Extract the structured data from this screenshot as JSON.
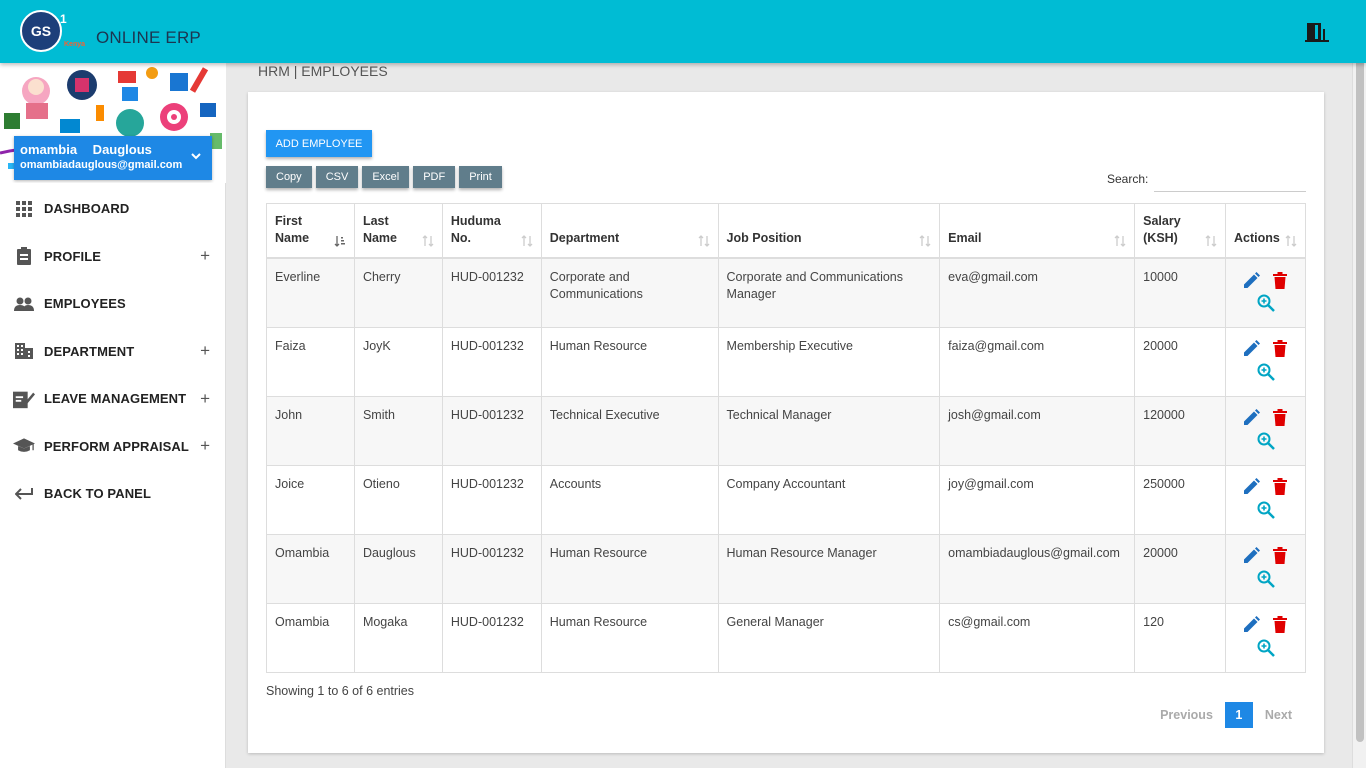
{
  "header": {
    "logo_text": "GS",
    "logo_number": "1",
    "logo_sub": "Kenya",
    "app_title": "ONLINE ERP",
    "exit_icon": "exit-door-icon"
  },
  "user": {
    "name": "omambia Dauglous",
    "email": "omambiadauglous@gmail.com"
  },
  "sidebar": {
    "items": [
      {
        "label": "DASHBOARD",
        "icon": "grid-icon",
        "expandable": false
      },
      {
        "label": "PROFILE",
        "icon": "clipboard-icon",
        "expandable": true
      },
      {
        "label": "EMPLOYEES",
        "icon": "people-icon",
        "expandable": false
      },
      {
        "label": "DEPARTMENT",
        "icon": "building-icon",
        "expandable": true
      },
      {
        "label": "LEAVE MANAGEMENT",
        "icon": "edit-doc-icon",
        "expandable": true
      },
      {
        "label": "PERFORM APPRAISAL",
        "icon": "graduation-cap-icon",
        "expandable": true
      },
      {
        "label": "BACK TO PANEL",
        "icon": "arrow-back-icon",
        "expandable": false
      }
    ],
    "plus": "+"
  },
  "breadcrumb": "HRM | EMPLOYEES",
  "toolbar": {
    "add_label": "ADD EMPLOYEE",
    "export_buttons": [
      "Copy",
      "CSV",
      "Excel",
      "PDF",
      "Print"
    ],
    "search_label": "Search:",
    "search_value": ""
  },
  "table": {
    "headers": [
      [
        "First",
        "Name"
      ],
      [
        "Last",
        "Name"
      ],
      [
        "Huduma",
        "No."
      ],
      [
        "Department"
      ],
      [
        "Job Position"
      ],
      [
        "Email"
      ],
      [
        "Salary",
        "(KSH)"
      ],
      [
        "Actions"
      ]
    ],
    "rows": [
      [
        "Everline",
        "Cherry",
        "HUD-001232",
        "Corporate and Communications",
        "Corporate and Communications Manager",
        "eva@gmail.com",
        "10000"
      ],
      [
        "Faiza",
        "JoyK",
        "HUD-001232",
        "Human Resource",
        "Membership Executive",
        "faiza@gmail.com",
        "20000"
      ],
      [
        "John",
        "Smith",
        "HUD-001232",
        "Technical Executive",
        "Technical Manager",
        "josh@gmail.com",
        "120000"
      ],
      [
        "Joice",
        "Otieno",
        "HUD-001232",
        "Accounts",
        "Company Accountant",
        "joy@gmail.com",
        "250000"
      ],
      [
        "Omambia",
        "Dauglous",
        "HUD-001232",
        "Human Resource",
        "Human Resource Manager",
        "omambiadauglous@gmail.com",
        "20000"
      ],
      [
        "Omambia",
        "Mogaka",
        "HUD-001232",
        "Human Resource",
        "General Manager",
        "cs@gmail.com",
        "120"
      ]
    ],
    "action_icons": [
      "pencil-icon",
      "trash-icon",
      "zoom-in-icon"
    ]
  },
  "footer": {
    "info": "Showing 1 to 6 of 6 entries",
    "previous": "Previous",
    "current_page": "1",
    "next": "Next"
  },
  "colors": {
    "topbar": "#00bcd4",
    "primary": "#2196f3",
    "export": "#607d8b",
    "edit": "#1e6fbf",
    "delete": "#e00000",
    "view": "#00a5c4"
  }
}
